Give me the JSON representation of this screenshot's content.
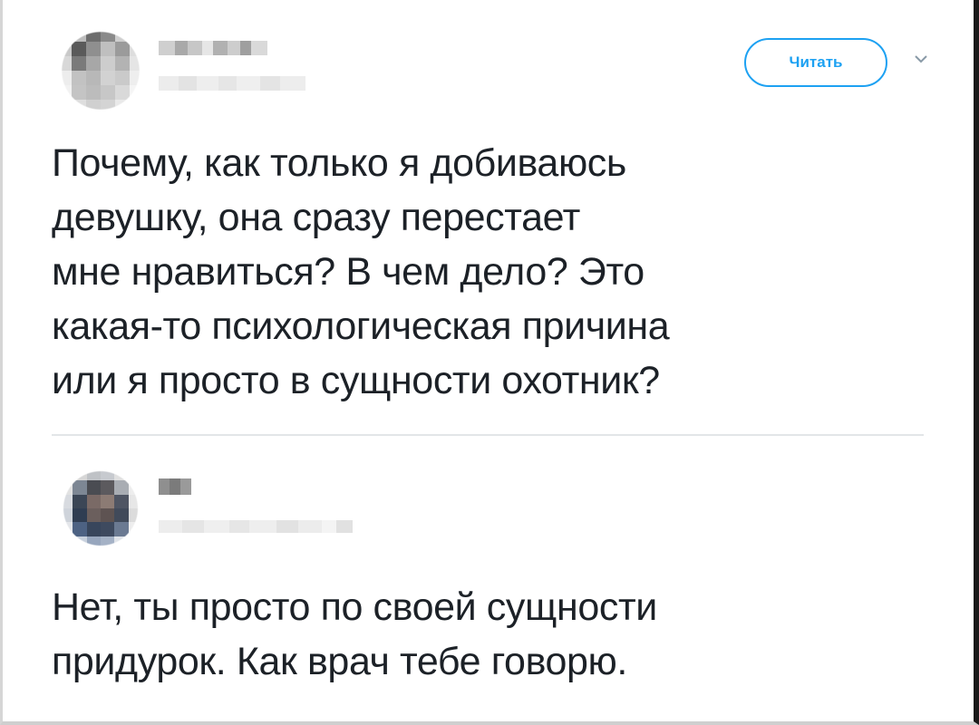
{
  "tweet_1": {
    "follow_button_label": "Читать",
    "text_lines": [
      "Почему, как только я добиваюсь",
      "девушку, она сразу перестает",
      "мне нравиться? В чем дело? Это",
      "какая-то психологическая причина",
      "или я просто в сущности охотник?"
    ]
  },
  "tweet_2": {
    "text_lines": [
      "Нет, ты просто по своей сущности",
      "придурок. Как врач тебе говорю."
    ]
  },
  "colors": {
    "accent": "#1da1f2",
    "text": "#1c2127",
    "divider": "#e3e6e8"
  },
  "icons": {
    "menu": "chevron-down-icon"
  }
}
